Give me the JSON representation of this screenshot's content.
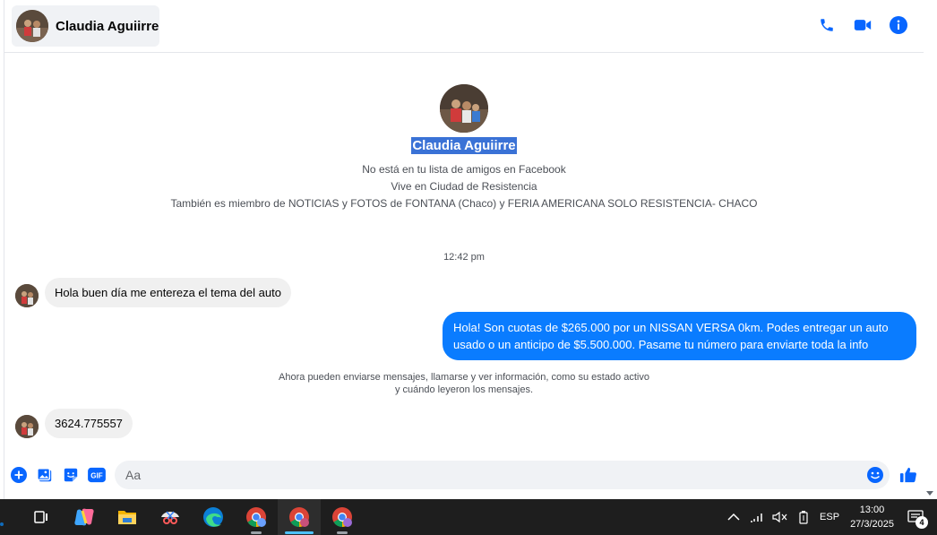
{
  "header": {
    "contact_name": "Claudia Aguiirre",
    "icons": [
      "phone-icon",
      "video-icon",
      "info-icon"
    ]
  },
  "profile": {
    "name": "Claudia Aguiirre",
    "line1": "No está en tu lista de amigos en Facebook",
    "line2": "Vive en Ciudad de Resistencia",
    "line3": "También es miembro de NOTICIAS y FOTOS de FONTANA (Chaco) y FERIA AMERICANA SOLO RESISTENCIA- CHACO"
  },
  "conversation": {
    "timestamp": "12:42 pm",
    "messages": [
      {
        "from": "contact",
        "text": "Hola buen día me entereza el tema del auto"
      },
      {
        "from": "me",
        "text": "Hola! Son cuotas de $265.000 por un NISSAN VERSA 0km. Podes entregar un auto usado o un anticipo de $5.500.000. Pasame tu número para enviarte toda la info"
      },
      {
        "from": "contact",
        "text": "3624.775557"
      }
    ],
    "notice_line1": "Ahora pueden enviarse mensajes, llamarse y ver información, como su estado activo",
    "notice_line2": "y cuándo leyeron los mensajes."
  },
  "composer": {
    "placeholder": "Aa",
    "gif_label": "GIF",
    "icons": [
      "plus-icon",
      "image-icon",
      "sticker-icon",
      "gif-icon",
      "emoji-icon",
      "like-icon"
    ]
  },
  "taskbar": {
    "apps": [
      "task-view-icon",
      "copilot-icon",
      "file-explorer-icon",
      "snipping-tool-icon",
      "edge-icon",
      "chrome-icon",
      "chrome-icon",
      "chrome-icon"
    ],
    "language": "ESP",
    "time": "13:00",
    "date": "27/3/2025",
    "notification_count": "4"
  },
  "colors": {
    "accent": "#0866ff",
    "outgoing_bubble": "#0a7cff",
    "incoming_bubble": "#f0f0f0",
    "selection": "#3a72d6"
  }
}
